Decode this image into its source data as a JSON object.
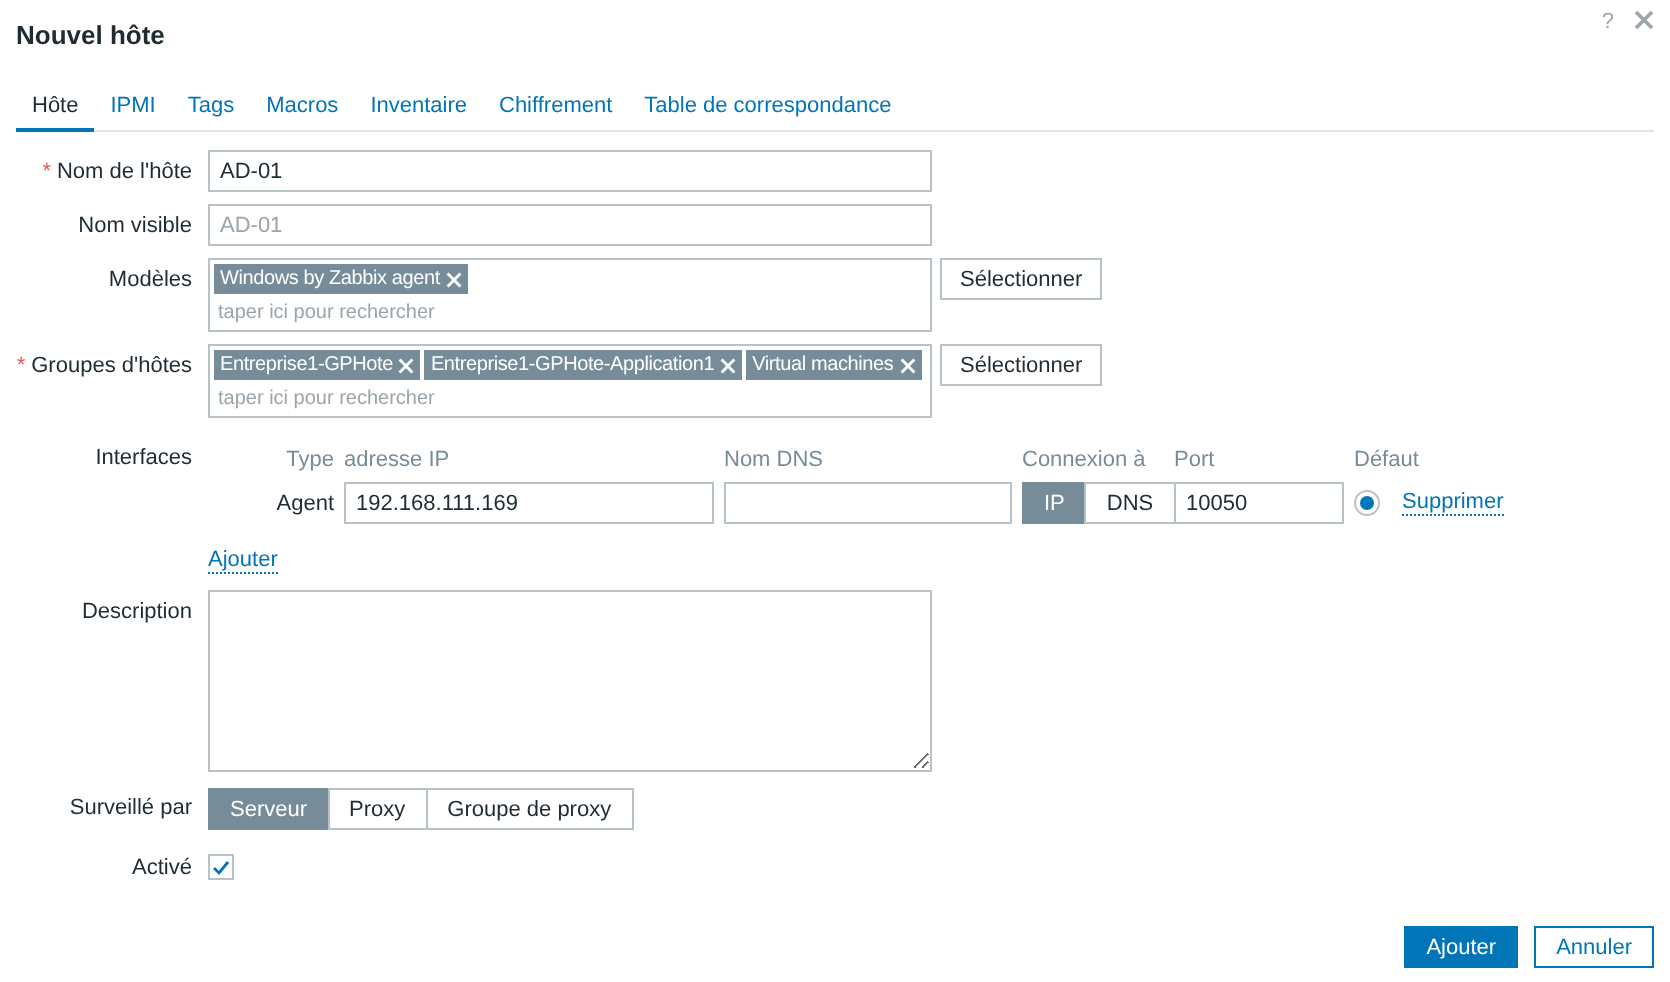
{
  "window": {
    "title": "Nouvel hôte",
    "help": "?"
  },
  "tabs": [
    {
      "label": "Hôte",
      "selected": true
    },
    {
      "label": "IPMI",
      "selected": false
    },
    {
      "label": "Tags",
      "selected": false
    },
    {
      "label": "Macros",
      "selected": false
    },
    {
      "label": "Inventaire",
      "selected": false
    },
    {
      "label": "Chiffrement",
      "selected": false
    },
    {
      "label": "Table de correspondance",
      "selected": false
    }
  ],
  "host_name": {
    "label": "Nom de l'hôte",
    "required_mark": "*",
    "value": "AD-01"
  },
  "visible_name": {
    "label": "Nom visible",
    "placeholder": "AD-01"
  },
  "templates": {
    "label": "Modèles",
    "tags": [
      "Windows by Zabbix agent"
    ],
    "placeholder": "taper ici pour rechercher",
    "button": "Sélectionner"
  },
  "host_groups": {
    "label": "Groupes d'hôtes",
    "required_mark": "*",
    "tags": [
      "Entreprise1-GPHote",
      "Entreprise1-GPHote-Application1",
      "Virtual machines"
    ],
    "placeholder": "taper ici pour rechercher",
    "button": "Sélectionner"
  },
  "interfaces": {
    "label": "Interfaces",
    "columns": [
      "Type",
      "adresse IP",
      "Nom DNS",
      "Connexion à",
      "Port",
      "Défaut"
    ],
    "rows": [
      {
        "type": "Agent",
        "ip": "192.168.111.169",
        "dns": "",
        "connect": [
          {
            "label": "IP",
            "selected": true
          },
          {
            "label": "DNS",
            "selected": false
          }
        ],
        "port": "10050",
        "default": true,
        "remove": "Supprimer"
      }
    ],
    "add": "Ajouter"
  },
  "description": {
    "label": "Description"
  },
  "monitored_by": {
    "label": "Surveillé par",
    "options": [
      {
        "label": "Serveur",
        "selected": true
      },
      {
        "label": "Proxy",
        "selected": false
      },
      {
        "label": "Groupe de proxy",
        "selected": false
      }
    ]
  },
  "enabled": {
    "label": "Activé",
    "checked": true
  },
  "buttons": [
    {
      "label": "Ajouter",
      "kind": "primary"
    },
    {
      "label": "Annuler",
      "kind": "secondary"
    }
  ]
}
